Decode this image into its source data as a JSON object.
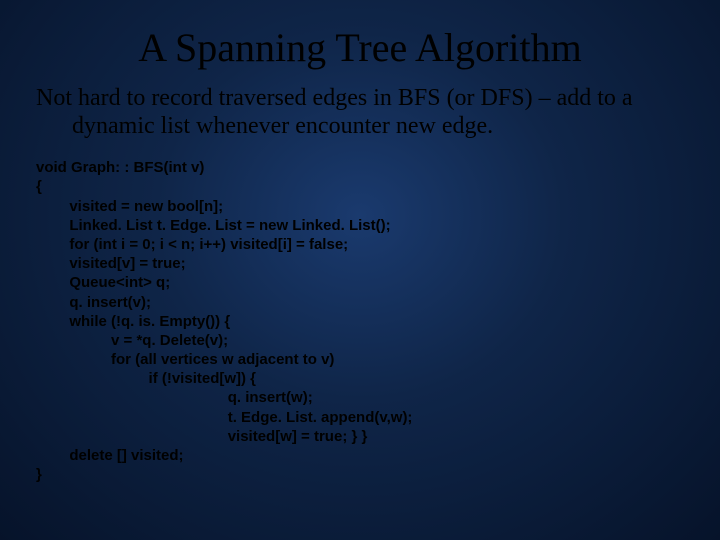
{
  "slide": {
    "title": "A Spanning Tree Algorithm",
    "intro": "Not hard to record traversed edges in BFS (or DFS) – add to a dynamic list whenever encounter new edge.",
    "code": "void Graph: : BFS(int v)\n{\n        visited = new bool[n];\n        Linked. List t. Edge. List = new Linked. List();\n        for (int i = 0; i < n; i++) visited[i] = false;\n        visited[v] = true;\n        Queue<int> q;\n        q. insert(v);\n        while (!q. is. Empty()) {\n                  v = *q. Delete(v);\n                  for (all vertices w adjacent to v)\n                           if (!visited[w]) {\n                                              q. insert(w);\n                                              t. Edge. List. append(v,w);\n                                              visited[w] = true; } }\n        delete [] visited;\n}"
  }
}
